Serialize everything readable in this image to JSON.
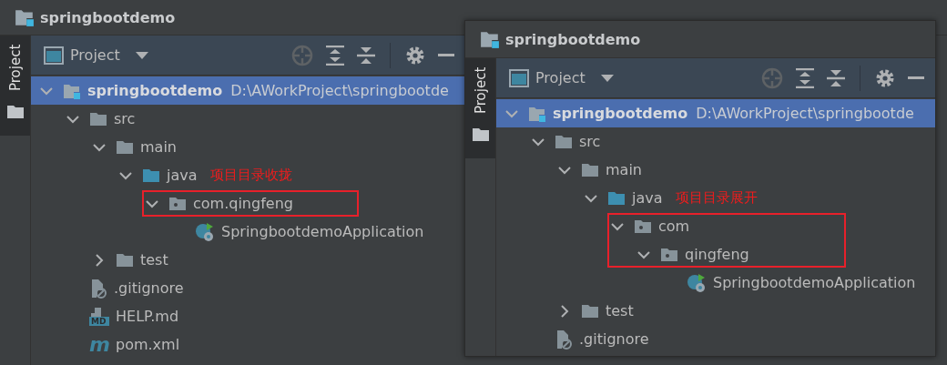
{
  "panels": [
    {
      "title": "springbootdemo",
      "side_tab": "Project",
      "view": "Project",
      "tree": [
        {
          "label": "springbootdemo",
          "path": "D:\\AWorkProject\\springbootde",
          "kind": "project",
          "expanded": true,
          "selected": true,
          "boxed": false,
          "children": [
            {
              "label": "src",
              "kind": "folder",
              "expanded": true,
              "selected": false,
              "boxed": false,
              "children": [
                {
                  "label": "main",
                  "kind": "folder",
                  "expanded": true,
                  "selected": false,
                  "boxed": false,
                  "children": [
                    {
                      "label": "java",
                      "kind": "source-folder",
                      "expanded": true,
                      "selected": false,
                      "boxed": false,
                      "note": "项目目录收拢",
                      "children": [
                        {
                          "label": "com.qingfeng",
                          "kind": "package",
                          "expanded": true,
                          "selected": false,
                          "boxed": true,
                          "children": [
                            {
                              "label": "SpringbootdemoApplication",
                              "kind": "spring-class",
                              "selected": false,
                              "boxed": false
                            }
                          ]
                        }
                      ]
                    }
                  ]
                },
                {
                  "label": "test",
                  "kind": "folder",
                  "expanded": false,
                  "selected": false,
                  "boxed": false
                }
              ]
            },
            {
              "label": ".gitignore",
              "kind": "ignore-file",
              "selected": false,
              "boxed": false
            },
            {
              "label": "HELP.md",
              "kind": "markdown",
              "badge": "MD",
              "selected": false,
              "boxed": false
            },
            {
              "label": "pom.xml",
              "kind": "maven",
              "badge": "m",
              "selected": false,
              "boxed": false
            }
          ]
        }
      ]
    },
    {
      "title": "springbootdemo",
      "side_tab": "Project",
      "view": "Project",
      "tree": [
        {
          "label": "springbootdemo",
          "path": "D:\\AWorkProject\\springbootde",
          "kind": "project",
          "expanded": true,
          "selected": true,
          "boxed": false,
          "children": [
            {
              "label": "src",
              "kind": "folder",
              "expanded": true,
              "selected": false,
              "boxed": false,
              "children": [
                {
                  "label": "main",
                  "kind": "folder",
                  "expanded": true,
                  "selected": false,
                  "boxed": false,
                  "children": [
                    {
                      "label": "java",
                      "kind": "source-folder",
                      "expanded": true,
                      "selected": false,
                      "boxed": false,
                      "note": "项目目录展开",
                      "children": [
                        {
                          "label": "com",
                          "kind": "package",
                          "expanded": true,
                          "selected": false,
                          "boxed": true,
                          "children": [
                            {
                              "label": "qingfeng",
                              "kind": "package",
                              "expanded": true,
                              "selected": false,
                              "boxed": true,
                              "children": [
                                {
                                  "label": "SpringbootdemoApplication",
                                  "kind": "spring-class",
                                  "selected": false,
                                  "boxed": false
                                }
                              ]
                            }
                          ]
                        }
                      ]
                    }
                  ]
                },
                {
                  "label": "test",
                  "kind": "folder",
                  "expanded": false,
                  "selected": false,
                  "boxed": false
                }
              ]
            },
            {
              "label": ".gitignore",
              "kind": "ignore-file",
              "selected": false,
              "boxed": false
            }
          ]
        }
      ]
    }
  ]
}
